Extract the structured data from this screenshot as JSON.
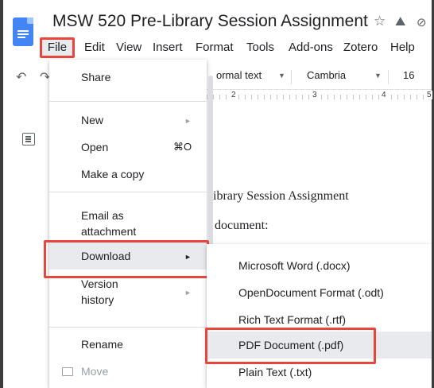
{
  "app": {
    "title": "MSW 520 Pre-Library Session Assignment"
  },
  "header_icons": {
    "star": "☆",
    "drive": "⛰",
    "cloud": "⊘"
  },
  "menubar": {
    "file": "File",
    "edit": "Edit",
    "view": "View",
    "insert": "Insert",
    "format": "Format",
    "tools": "Tools",
    "addons": "Add-ons",
    "zotero": "Zotero",
    "help": "Help"
  },
  "toolbar": {
    "undo": "↶",
    "redo": "↷",
    "style_value": "ormal text",
    "font_value": "Cambria",
    "font_size": "16"
  },
  "ruler": {
    "n2": "2",
    "n3": "3",
    "n4": "4",
    "n5": "5"
  },
  "document": {
    "line1": "ibrary Session Assignment",
    "line2": "document:"
  },
  "file_menu": {
    "share": "Share",
    "new": "New",
    "open": "Open",
    "open_shortcut": "⌘O",
    "make_copy": "Make a copy",
    "email_line1": "Email as",
    "email_line2": "attachment",
    "download": "Download",
    "version_line1": "Version",
    "version_line2": "history",
    "rename": "Rename",
    "move": "Move",
    "arrow": "►"
  },
  "download_submenu": {
    "docx": "Microsoft Word (.docx)",
    "odt": "OpenDocument Format (.odt)",
    "rtf": "Rich Text Format (.rtf)",
    "pdf": "PDF Document (.pdf)",
    "txt": "Plain Text (.txt)"
  },
  "colors": {
    "highlight": "#e8463d",
    "docs_blue": "#4285f4",
    "hover_bg": "#e8eaed"
  }
}
